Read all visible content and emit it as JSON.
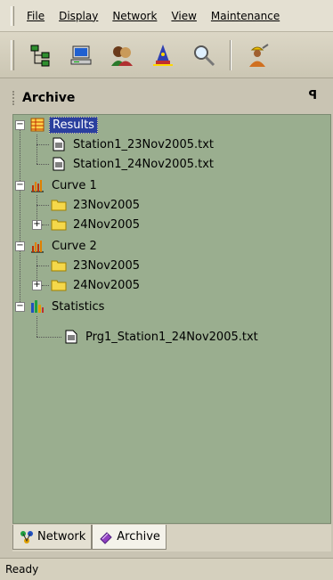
{
  "menu": {
    "items": [
      {
        "label": "File"
      },
      {
        "label": "Display"
      },
      {
        "label": "Network"
      },
      {
        "label": "View"
      },
      {
        "label": "Maintenance"
      }
    ]
  },
  "toolbar": {
    "buttons": [
      "network-tree-icon",
      "computer-icon",
      "users-icon",
      "wizard-icon",
      "magnifier-icon",
      "worker-icon"
    ]
  },
  "panel": {
    "title": "Archive",
    "pin_glyph": "ꟼ"
  },
  "tree": {
    "results": "Results",
    "results_file_1": "Station1_23Nov2005.txt",
    "results_file_2": "Station1_24Nov2005.txt",
    "curve1": "Curve 1",
    "curve1_folder_1": "23Nov2005",
    "curve1_folder_2": "24Nov2005",
    "curve2": "Curve 2",
    "curve2_folder_1": "23Nov2005",
    "curve2_folder_2": "24Nov2005",
    "statistics": "Statistics",
    "statistics_file_1": "Prg1_Station1_24Nov2005.txt"
  },
  "tabs": {
    "network": "Network",
    "archive": "Archive"
  },
  "status": {
    "text": "Ready"
  },
  "colors": {
    "tree_background": "#9aae8f",
    "selection": "#2a3f9e",
    "chrome": "#dcd7c6"
  }
}
